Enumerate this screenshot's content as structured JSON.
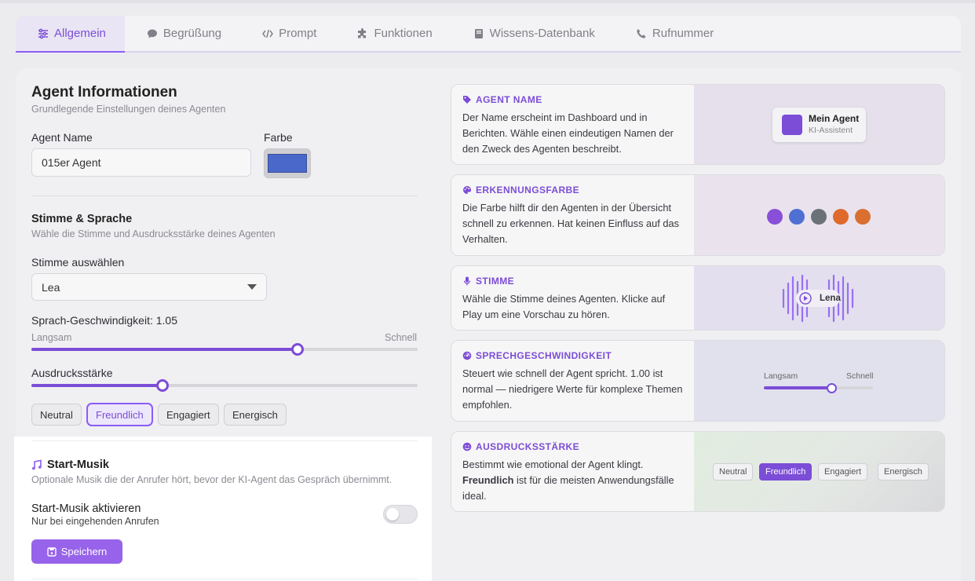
{
  "tabs": [
    {
      "label": "Allgemein",
      "icon": "sliders-icon",
      "active": true
    },
    {
      "label": "Begrüßung",
      "icon": "speech-bubble-icon"
    },
    {
      "label": "Prompt",
      "icon": "code-icon"
    },
    {
      "label": "Funktionen",
      "icon": "puzzle-icon"
    },
    {
      "label": "Wissens-Datenbank",
      "icon": "book-icon"
    },
    {
      "label": "Rufnummer",
      "icon": "phone-icon"
    }
  ],
  "agent_info": {
    "title": "Agent Informationen",
    "subtitle": "Grundlegende Einstellungen deines Agenten",
    "name_label": "Agent Name",
    "name_value": "015er Agent",
    "color_label": "Farbe",
    "color_value": "#4a68c9"
  },
  "voice": {
    "title": "Stimme & Sprache",
    "subtitle": "Wähle die Stimme und Ausdrucksstärke deines Agenten",
    "select_label": "Stimme auswählen",
    "select_value": "Lea",
    "speed_label": "Sprach-Geschwindigkeit: 1.05",
    "speed_min_label": "Langsam",
    "speed_max_label": "Schnell",
    "speed_fraction": 0.69,
    "expression_label": "Ausdrucksstärke",
    "expression_fraction": 0.34,
    "expression_options": [
      "Neutral",
      "Freundlich",
      "Engagiert",
      "Energisch"
    ],
    "expression_selected": "Freundlich"
  },
  "music": {
    "title": "Start-Musik",
    "subtitle": "Optionale Musik die der Anrufer hört, bevor der KI-Agent das Gespräch übernimmt.",
    "toggle_label": "Start-Musik aktivieren",
    "toggle_hint": "Nur bei eingehenden Anrufen",
    "toggle_on": false,
    "save_label": "Speichern"
  },
  "info_cards": {
    "name": {
      "title": "AGENT NAME",
      "body": "Der Name erscheint im Dashboard und in Berichten. Wähle einen eindeutigen Namen der den Zweck des Agenten beschreibt.",
      "preview_title": "Mein Agent",
      "preview_sub": "KI-Assistent"
    },
    "color": {
      "title": "ERKENNUNGSFARBE",
      "body": "Die Farbe hilft dir den Agenten in der Übersicht schnell zu erkennen. Hat keinen Einfluss auf das Verhalten.",
      "swatches": [
        "#8a4fd8",
        "#4f6fd2",
        "#6b7178",
        "#de6a2c",
        "#d9702f"
      ]
    },
    "voice": {
      "title": "STIMME",
      "body": "Wähle die Stimme deines Agenten. Klicke auf Play um eine Vorschau zu hören.",
      "preview_name": "Lena"
    },
    "speed": {
      "title": "SPRECHGESCHWINDIGKEIT",
      "body": "Steuert wie schnell der Agent spricht. 1.00 ist normal — niedrigere Werte für komplexe Themen empfohlen.",
      "min_label": "Langsam",
      "max_label": "Schnell",
      "fraction": 0.62
    },
    "expression": {
      "title": "AUSDRUCKSSTÄRKE",
      "body_bold": "Freundlich",
      "body_rest": " ist für die meisten Anwendungsfälle ideal.",
      "body_intro": "Bestimmt wie emotional der Agent klingt.",
      "options": [
        "Neutral",
        "Freundlich",
        "Engagiert",
        "Energisch"
      ],
      "selected": "Freundlich"
    }
  },
  "colors": {
    "accent": "#7c4dd6",
    "button": "#9763ea"
  }
}
